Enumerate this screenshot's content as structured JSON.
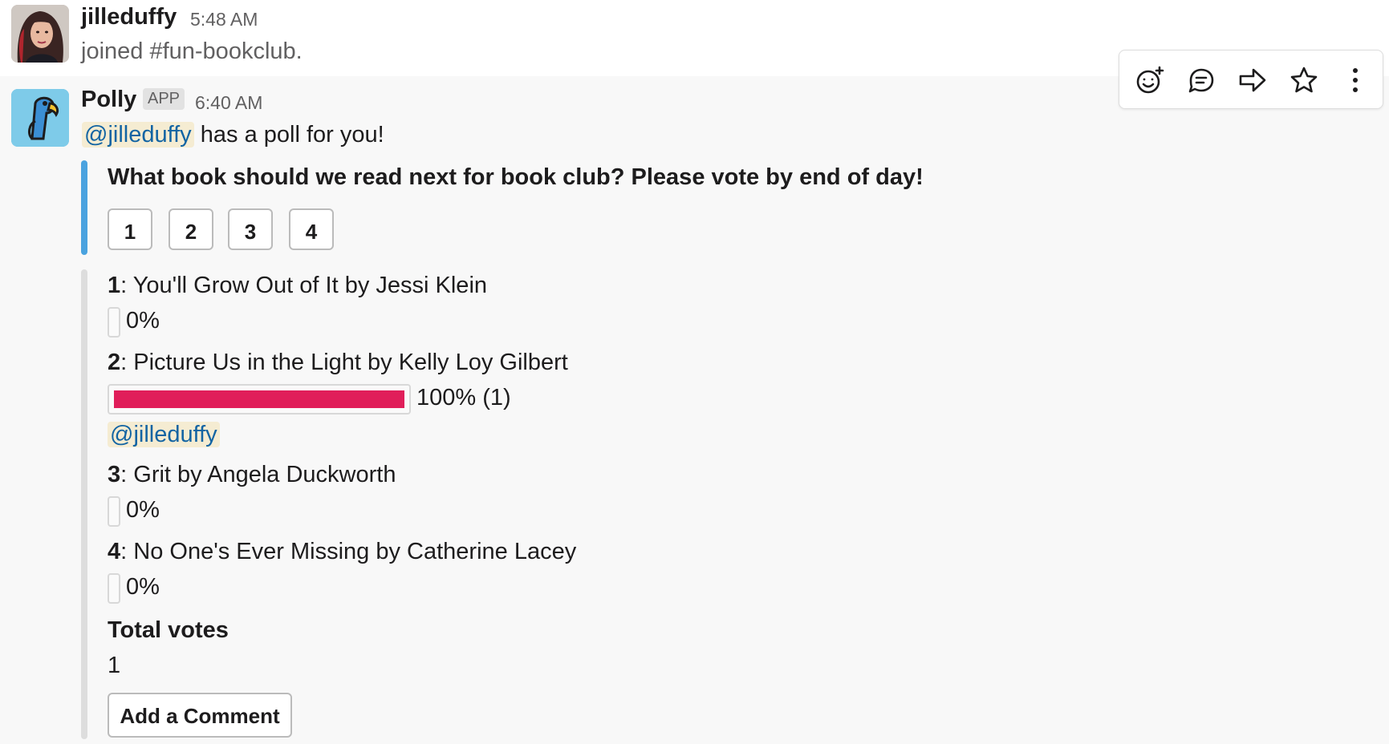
{
  "messages": [
    {
      "author": "jilleduffy",
      "time": "5:48 AM",
      "text": "joined #fun-bookclub."
    },
    {
      "author": "Polly",
      "badge": "APP",
      "time": "6:40 AM",
      "mention": "@jilleduffy",
      "intro": "has a poll for you!"
    }
  ],
  "poll": {
    "question": "What book should we read next for book club? Please vote by end of day!",
    "vote_buttons": [
      "1",
      "2",
      "3",
      "4"
    ],
    "options": [
      {
        "num": "1",
        "sep": ":",
        "title": " You'll Grow Out of It by Jessi Klein",
        "percent": 0,
        "percent_label": "0%"
      },
      {
        "num": "2",
        "sep": ":",
        "title": " Picture Us in the Light by Kelly Loy Gilbert",
        "percent": 100,
        "percent_label": "100% (1)",
        "voters": [
          "@jilleduffy"
        ]
      },
      {
        "num": "3",
        "sep": ":",
        "title": " Grit by Angela Duckworth",
        "percent": 0,
        "percent_label": "0%"
      },
      {
        "num": "4",
        "sep": ":",
        "title": " No One's Ever Missing by Catherine Lacey",
        "percent": 0,
        "percent_label": "0%"
      }
    ],
    "total_label": "Total votes",
    "total_value": "1",
    "comment_button": "Add a Comment"
  },
  "toolbar_icons": [
    "add-reaction-icon",
    "reply-thread-icon",
    "share-forward-icon",
    "star-icon",
    "more-actions-icon"
  ],
  "colors": {
    "accent_bar": "#4aa3df",
    "vote_fill": "#e01e5a",
    "mention_bg": "#f5ecd2",
    "mention_text": "#1264a3"
  }
}
